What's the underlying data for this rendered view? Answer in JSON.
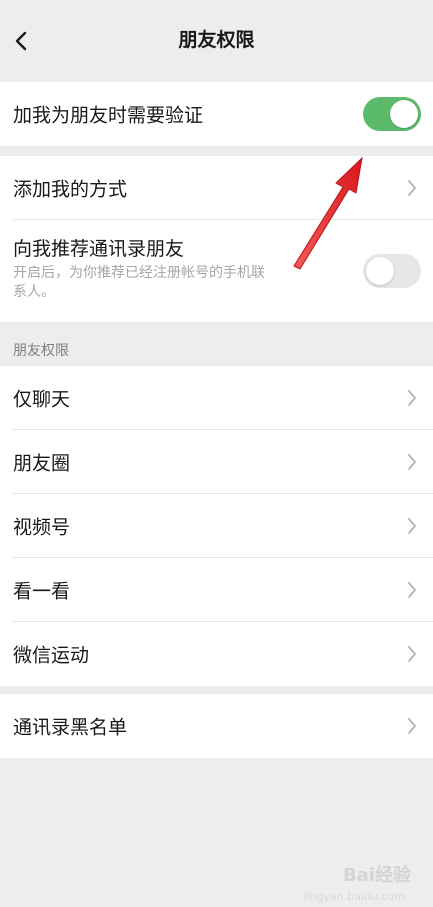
{
  "nav": {
    "title": "朋友权限",
    "back_icon": "chevron-left-icon"
  },
  "verify_group": {
    "label": "加我为朋友时需要验证",
    "toggle_on": true,
    "toggle_color": "#5cbb6a"
  },
  "add_group": {
    "add_method_label": "添加我的方式",
    "recommend_title": "向我推荐通讯录朋友",
    "recommend_desc": "开启后，为你推荐已经注册帐号的手机联系人。",
    "recommend_toggle_on": false
  },
  "permissions": {
    "header": "朋友权限",
    "items": [
      {
        "label": "仅聊天"
      },
      {
        "label": "朋友圈"
      },
      {
        "label": "视频号"
      },
      {
        "label": "看一看"
      },
      {
        "label": "微信运动"
      }
    ]
  },
  "blacklist": {
    "label": "通讯录黑名单"
  },
  "annotation": {
    "color": "#e8262a"
  },
  "watermark": {
    "text": "Bai经验",
    "sub": "jingyan.baidu.com"
  }
}
